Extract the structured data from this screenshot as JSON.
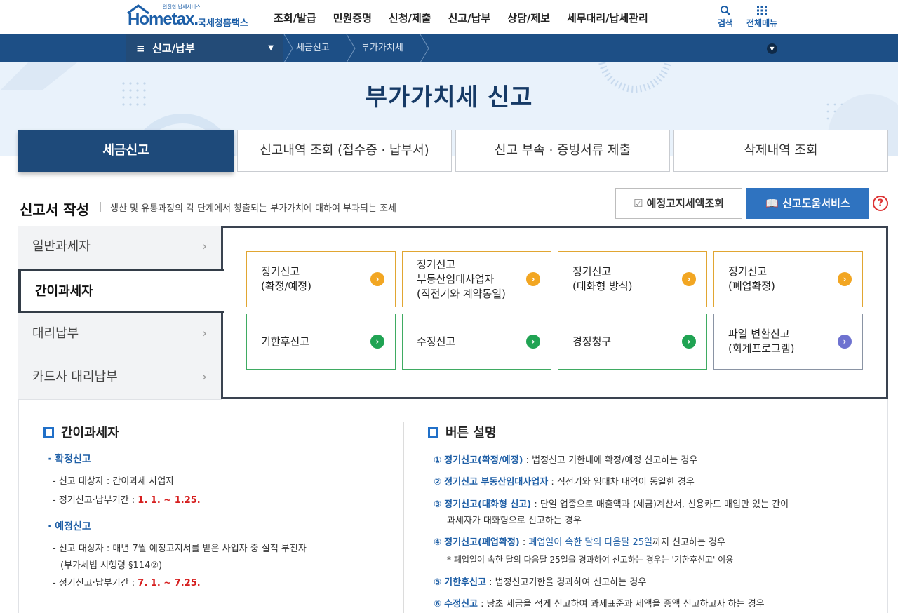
{
  "header": {
    "logo_tag": "안전한 납세서비스",
    "logo_text": "Hometax.",
    "logo_name": "국세청홈택스",
    "menu": [
      "조회/발급",
      "민원증명",
      "신청/제출",
      "신고/납부",
      "상담/제보",
      "세무대리/납세관리"
    ],
    "search_label": "검색",
    "allmenu_label": "전체메뉴"
  },
  "nav": {
    "current_menu": "신고/납부",
    "crumbs": [
      "세금신고",
      "부가가치세"
    ]
  },
  "page_title": "부가가치세 신고",
  "tabs": [
    "세금신고",
    "신고내역 조회 (접수증 · 납부서)",
    "신고 부속 · 증빙서류 제출",
    "삭제내역 조회"
  ],
  "section": {
    "title": "신고서 작성",
    "desc": "생산 및 유통과정의 각 단계에서 창출되는 부가가치에 대하여 부과되는 조세",
    "btn_estimate": "예정고지세액조회",
    "btn_help": "신고도움서비스",
    "help_mark": "?"
  },
  "side_menu": [
    "일반과세자",
    "간이과세자",
    "대리납부",
    "카드사 대리납부"
  ],
  "cards": [
    {
      "l1": "정기신고",
      "l2": "(확정/예정)",
      "l3": ""
    },
    {
      "l1": "정기신고",
      "l2": "부동산임대사업자",
      "l3": "(직전기와 계약동일)"
    },
    {
      "l1": "정기신고",
      "l2": "(대화형 방식)",
      "l3": ""
    },
    {
      "l1": "정기신고",
      "l2": "(폐업확정)",
      "l3": ""
    },
    {
      "l1": "기한후신고",
      "l2": "",
      "l3": ""
    },
    {
      "l1": "수정신고",
      "l2": "",
      "l3": ""
    },
    {
      "l1": "경정청구",
      "l2": "",
      "l3": ""
    },
    {
      "l1": "파일 변환신고",
      "l2": "(회계프로그램)",
      "l3": ""
    }
  ],
  "left_info": {
    "title": "간이과세자",
    "confirm_head": "· 확정신고",
    "confirm_target": "- 신고 대상자 : 간이과세 사업자",
    "confirm_period_label": "- 정기신고·납부기간 : ",
    "confirm_period": "1. 1. ~ 1.25.",
    "prelim_head": "· 예정신고",
    "prelim_target": "- 신고 대상자 : 매년 7월 예정고지서를 받은 사업자 중 실적 부진자",
    "prelim_law": "(부가세법 시행령 §114②)",
    "prelim_period_label": "- 정기신고·납부기간 : ",
    "prelim_period": "7. 1. ~ 7.25."
  },
  "right_info": {
    "title": "버튼 설명",
    "items": [
      {
        "n": "①",
        "head": "정기신고(확정/예정)",
        "rest": " : 법정신고 기한내에 확정/예정 신고하는 경우"
      },
      {
        "n": "②",
        "head": "정기신고 부동산임대사업자",
        "rest": " : 직전기와 임대차 내역이 동일한 경우"
      },
      {
        "n": "③",
        "head": "정기신고(대화형 신고)",
        "rest": " : 단일 업종으로 매출액과 (세금)계산서, 신용카드 매입만 있는 간이"
      },
      {
        "n": "④",
        "head": "정기신고(폐업확정)",
        "rest_a": " : ",
        "rest_blue": "폐업일이 속한 달의 다음달 25일",
        "rest_b": "까지 신고하는 경우"
      },
      {
        "n": "⑤",
        "head": "기한후신고",
        "rest": " : 법정신고기한을 경과하여 신고하는 경우"
      },
      {
        "n": "⑥",
        "head": "수정신고",
        "rest": " : 당초 세금을 적게 신고하여 과세표준과 세액을 증액 신고하고자 하는 경우"
      }
    ],
    "item3_cont": "과세자가 대화형으로 신고하는 경우",
    "item4_note": "* 폐업일이 속한 달의 다음달 25일을 경과하여 신고하는 경우는 '기한후신고' 이용"
  }
}
